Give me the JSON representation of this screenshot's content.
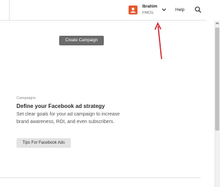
{
  "header": {
    "account_name": "Ibrahim",
    "account_org": "FMCG",
    "help_label": "Help"
  },
  "main": {
    "create_campaign_label": "Create Campaign"
  },
  "campaigns_section": {
    "label": "Campaigns",
    "title": "Define your Facebook ad strategy",
    "body": "Set clear goals for your ad campaign to increase brand awareness, ROI, and even subscribers.",
    "tips_button_label": "Tips For Facebook Ads"
  },
  "colors": {
    "avatar": "#e4572e",
    "primary_button": "#6b6b6b",
    "secondary_button": "#e3e3e3",
    "annotation_arrow": "#d0212a"
  },
  "icons": {
    "avatar": "user-icon",
    "account_menu": "chevron-down-icon",
    "search": "search-icon"
  }
}
